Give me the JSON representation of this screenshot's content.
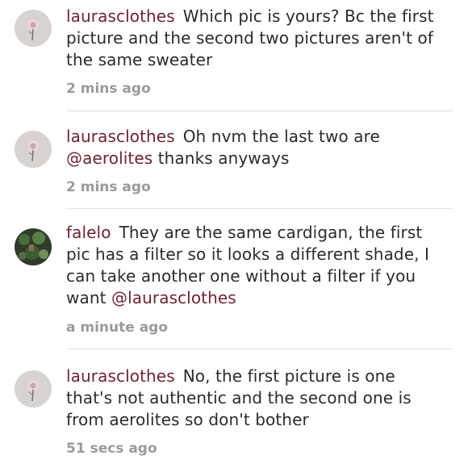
{
  "comments": [
    {
      "username": "laurasclothes",
      "text": "Which pic is yours? Bc the first picture and the second two pictures aren't of the same sweater",
      "mention": "",
      "time": "2 mins ago",
      "avatar": "flower-avatar-icon"
    },
    {
      "username": "laurasclothes",
      "text": "Oh nvm the last two are ",
      "mention": "@aerolites",
      "text_after": " thanks anyways",
      "time": "2 mins ago",
      "avatar": "flower-avatar-icon"
    },
    {
      "username": "falelo",
      "text": "They are the same cardigan, the first pic has a filter so it looks a different shade, I can take another one without a filter if you want ",
      "mention": "@laurasclothes",
      "time": "a minute ago",
      "avatar": "plants-avatar-icon"
    },
    {
      "username": "laurasclothes",
      "text": "No, the first picture is one that's not authentic and the second one is from aerolites so don't bother",
      "mention": "",
      "time": "51 secs ago",
      "avatar": "flower-avatar-icon"
    }
  ],
  "colors": {
    "username": "#6f2431",
    "body": "#2b2b2b",
    "time": "#9a9a9a",
    "divider": "#e2e2e2"
  }
}
